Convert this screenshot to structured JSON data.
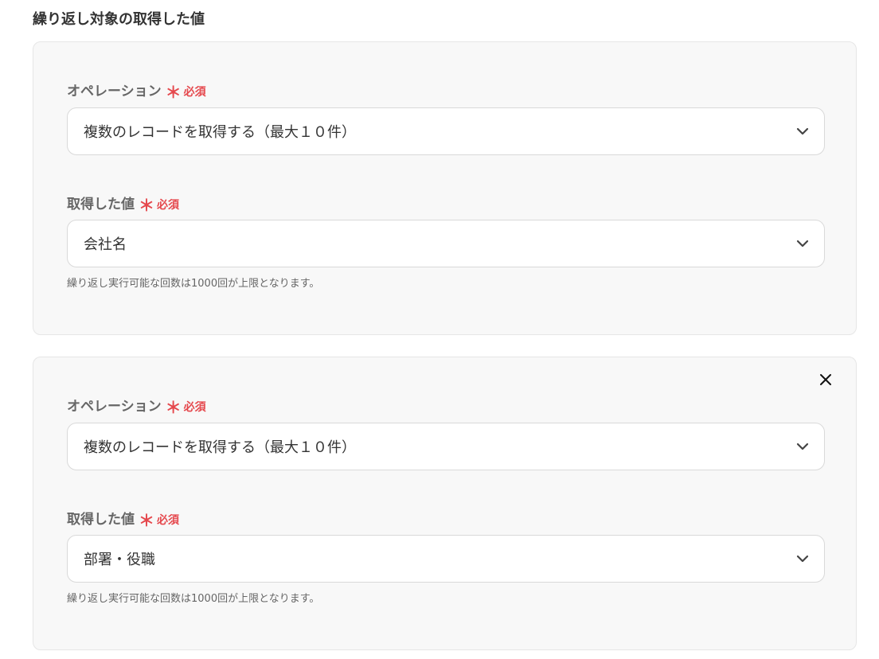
{
  "section": {
    "title": "繰り返し対象の取得した値"
  },
  "required_mark": "＊",
  "required_text": "必須",
  "cards": [
    {
      "operation_label": "オペレーション",
      "operation_value": "複数のレコードを取得する（最大１０件）",
      "value_label": "取得した値",
      "value_value": "会社名",
      "hint": "繰り返し実行可能な回数は1000回が上限となります。"
    },
    {
      "operation_label": "オペレーション",
      "operation_value": "複数のレコードを取得する（最大１０件）",
      "value_label": "取得した値",
      "value_value": "部署・役職",
      "hint": "繰り返し実行可能な回数は1000回が上限となります。"
    }
  ],
  "colors": {
    "required": "#e5484d",
    "card_background": "#f8f8f8"
  },
  "icons": {
    "close": "close-icon",
    "dropdown": "chevron-down-icon"
  }
}
